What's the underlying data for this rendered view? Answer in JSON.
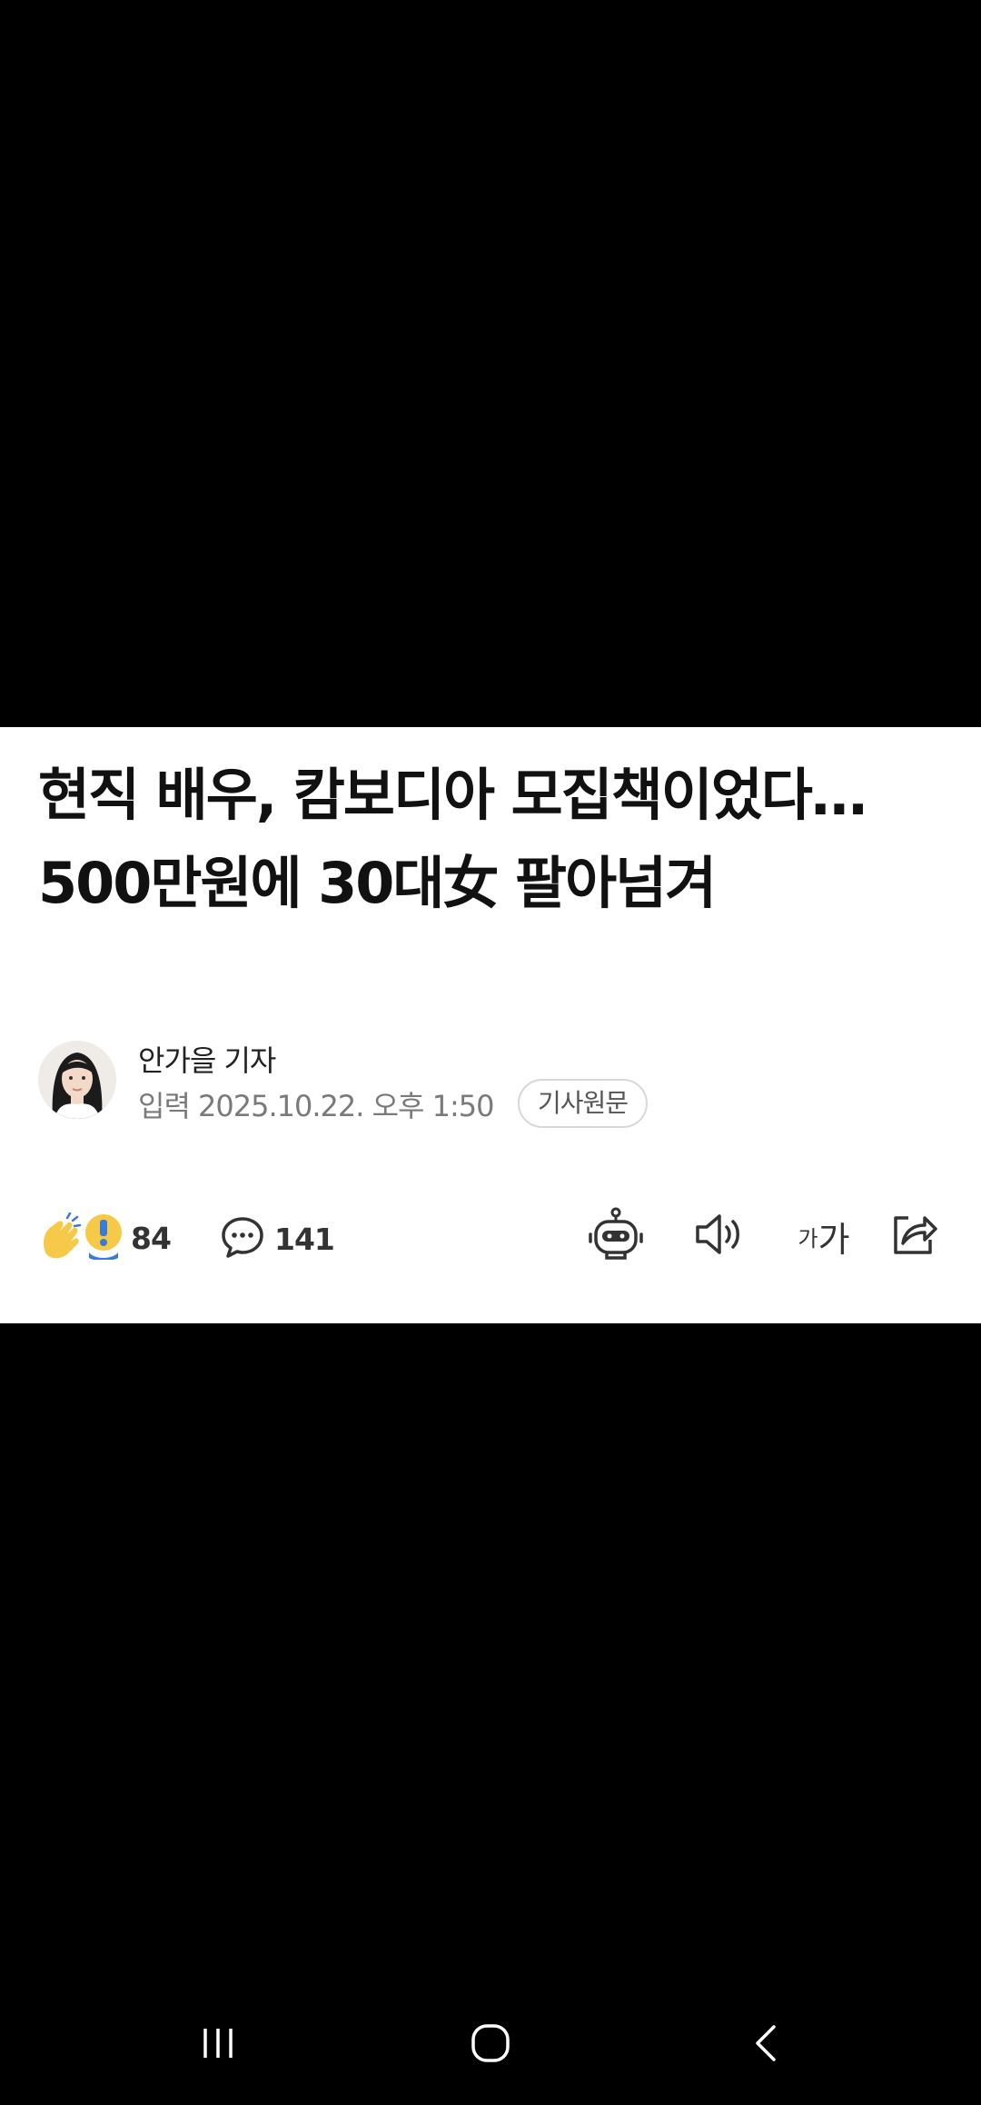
{
  "article": {
    "headline": "현직 배우, 캄보디아 모집책이었다… 500만원에 30대女 팔아넘겨",
    "reporter": "안가을 기자",
    "published": "입력 2025.10.22. 오후 1:50",
    "original_link_label": "기사원문"
  },
  "actions": {
    "reaction_count": "84",
    "comment_count": "141",
    "reaction_icon": "clap-surprise-icon",
    "comment_icon": "speech-bubble-icon"
  },
  "tools": {
    "summary_icon": "robot-icon",
    "tts_icon": "speaker-icon",
    "font_size_small": "가",
    "font_size_large": "가",
    "share_icon": "share-icon"
  },
  "navigation": {
    "recents_icon": "recents-icon",
    "home_icon": "home-icon",
    "back_icon": "back-icon"
  },
  "colors": {
    "background": "#000000",
    "card": "#ffffff",
    "headline": "#111111",
    "meta": "#7a7a7a",
    "reaction_yellow": "#f7c948",
    "reaction_blue": "#3a7bd5"
  }
}
